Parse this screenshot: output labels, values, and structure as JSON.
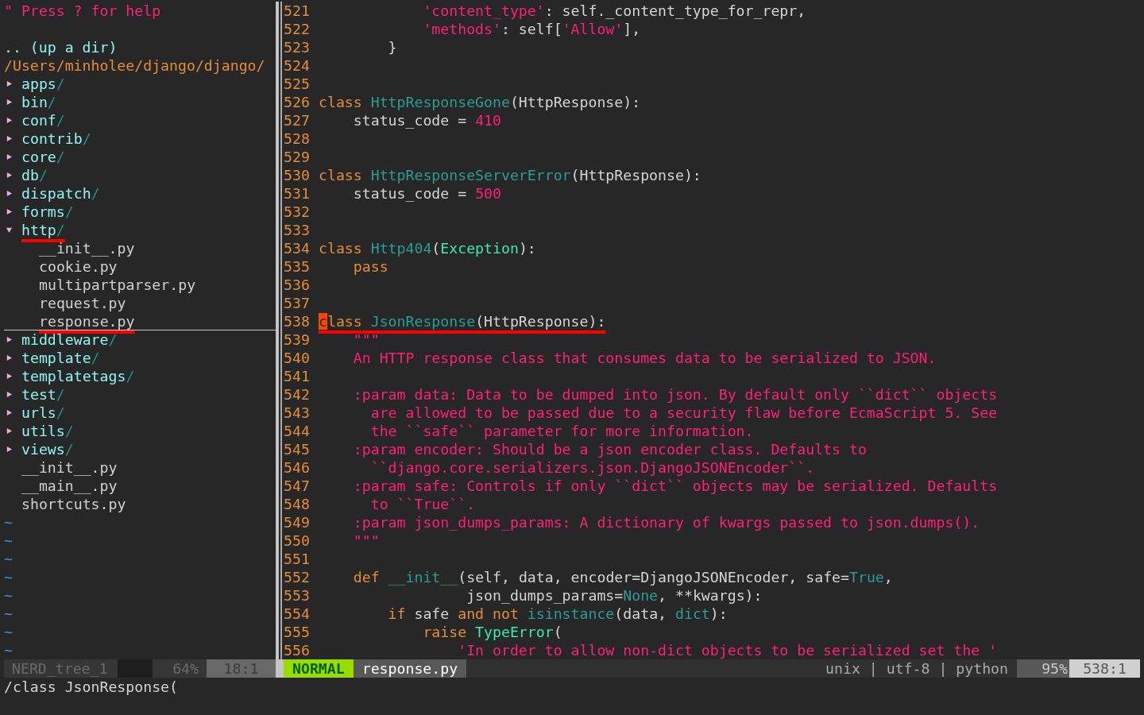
{
  "tree": {
    "help": "\" Press ? for help",
    "up_dir": ".. (up a dir)",
    "root_path": "/Users/minholee/django/django/",
    "items": [
      {
        "kind": "dir",
        "name": "apps",
        "slash": "/",
        "expanded": false,
        "selected": false,
        "marked": false
      },
      {
        "kind": "dir",
        "name": "bin",
        "slash": "/",
        "expanded": false,
        "selected": false,
        "marked": false
      },
      {
        "kind": "dir",
        "name": "conf",
        "slash": "/",
        "expanded": false,
        "selected": false,
        "marked": false
      },
      {
        "kind": "dir",
        "name": "contrib",
        "slash": "/",
        "expanded": false,
        "selected": false,
        "marked": false
      },
      {
        "kind": "dir",
        "name": "core",
        "slash": "/",
        "expanded": false,
        "selected": false,
        "marked": false
      },
      {
        "kind": "dir",
        "name": "db",
        "slash": "/",
        "expanded": false,
        "selected": false,
        "marked": false
      },
      {
        "kind": "dir",
        "name": "dispatch",
        "slash": "/",
        "expanded": false,
        "selected": false,
        "marked": false
      },
      {
        "kind": "dir",
        "name": "forms",
        "slash": "/",
        "expanded": false,
        "selected": false,
        "marked": false
      },
      {
        "kind": "dir",
        "name": "http",
        "slash": "/",
        "expanded": true,
        "selected": false,
        "marked": true,
        "children": [
          {
            "kind": "file",
            "name": "__init__.py",
            "selected": false,
            "marked": false
          },
          {
            "kind": "file",
            "name": "cookie.py",
            "selected": false,
            "marked": false
          },
          {
            "kind": "file",
            "name": "multipartparser.py",
            "selected": false,
            "marked": false
          },
          {
            "kind": "file",
            "name": "request.py",
            "selected": false,
            "marked": false
          },
          {
            "kind": "file",
            "name": "response.py",
            "selected": true,
            "marked": true
          }
        ]
      },
      {
        "kind": "dir",
        "name": "middleware",
        "slash": "/",
        "expanded": false,
        "selected": false,
        "marked": false
      },
      {
        "kind": "dir",
        "name": "template",
        "slash": "/",
        "expanded": false,
        "selected": false,
        "marked": false
      },
      {
        "kind": "dir",
        "name": "templatetags",
        "slash": "/",
        "expanded": false,
        "selected": false,
        "marked": false
      },
      {
        "kind": "dir",
        "name": "test",
        "slash": "/",
        "expanded": false,
        "selected": false,
        "marked": false
      },
      {
        "kind": "dir",
        "name": "urls",
        "slash": "/",
        "expanded": false,
        "selected": false,
        "marked": false
      },
      {
        "kind": "dir",
        "name": "utils",
        "slash": "/",
        "expanded": false,
        "selected": false,
        "marked": false
      },
      {
        "kind": "dir",
        "name": "views",
        "slash": "/",
        "expanded": false,
        "selected": false,
        "marked": false
      },
      {
        "kind": "file",
        "name": "__init__.py",
        "selected": false,
        "marked": false
      },
      {
        "kind": "file",
        "name": "__main__.py",
        "selected": false,
        "marked": false
      },
      {
        "kind": "file",
        "name": "shortcuts.py",
        "selected": false,
        "marked": false
      }
    ],
    "filler_lines": [
      "~",
      "~",
      "~",
      "~",
      "~",
      "~",
      "~",
      "~"
    ]
  },
  "code": [
    {
      "number": "521",
      "marked": false,
      "tokens": [
        {
          "kind": "str",
          "text": "            'content_type'"
        },
        {
          "kind": "plain",
          "text": ": self._content_type_for_repr,"
        }
      ]
    },
    {
      "number": "522",
      "marked": false,
      "tokens": [
        {
          "kind": "str",
          "text": "            'methods'"
        },
        {
          "kind": "plain",
          "text": ": self["
        },
        {
          "kind": "str",
          "text": "'Allow'"
        },
        {
          "kind": "plain",
          "text": "],"
        }
      ]
    },
    {
      "number": "523",
      "marked": false,
      "tokens": [
        {
          "kind": "plain",
          "text": "        }"
        }
      ]
    },
    {
      "number": "524",
      "marked": false
    },
    {
      "number": "525",
      "marked": false
    },
    {
      "number": "526",
      "marked": false,
      "tokens": [
        {
          "kind": "kw",
          "text": "class"
        },
        {
          "kind": "cls",
          "text": " HttpResponseGone"
        },
        {
          "kind": "plain",
          "text": "(HttpResponse):"
        }
      ]
    },
    {
      "number": "527",
      "marked": false,
      "tokens": [
        {
          "kind": "plain",
          "text": "    status_code = "
        },
        {
          "kind": "str",
          "text": "410"
        }
      ]
    },
    {
      "number": "528",
      "marked": false
    },
    {
      "number": "529",
      "marked": false
    },
    {
      "number": "530",
      "marked": false,
      "tokens": [
        {
          "kind": "kw",
          "text": "class"
        },
        {
          "kind": "cls",
          "text": " HttpResponseServerError"
        },
        {
          "kind": "plain",
          "text": "(HttpResponse):"
        }
      ]
    },
    {
      "number": "531",
      "marked": false,
      "tokens": [
        {
          "kind": "plain",
          "text": "    status_code = "
        },
        {
          "kind": "str",
          "text": "500"
        }
      ]
    },
    {
      "number": "532",
      "marked": false
    },
    {
      "number": "533",
      "marked": false
    },
    {
      "number": "534",
      "marked": false,
      "tokens": [
        {
          "kind": "kw",
          "text": "class"
        },
        {
          "kind": "cls",
          "text": " Http404"
        },
        {
          "kind": "plain",
          "text": "("
        },
        {
          "kind": "exc",
          "text": "Exception"
        },
        {
          "kind": "plain",
          "text": "):"
        }
      ]
    },
    {
      "number": "535",
      "marked": false,
      "tokens": [
        {
          "kind": "kw",
          "text": "    pass"
        }
      ]
    },
    {
      "number": "536",
      "marked": false
    },
    {
      "number": "537",
      "marked": false
    },
    {
      "number": "538",
      "marked": true,
      "tokens": [
        {
          "kind": "cursor",
          "text": "c"
        },
        {
          "kind": "kw",
          "text": "lass"
        },
        {
          "kind": "cls",
          "text": " JsonResponse"
        },
        {
          "kind": "plain",
          "text": "(HttpResponse):"
        }
      ]
    },
    {
      "number": "539",
      "marked": false,
      "tokens": [
        {
          "kind": "str",
          "text": "    \"\"\""
        }
      ]
    },
    {
      "number": "540",
      "marked": false,
      "tokens": [
        {
          "kind": "str",
          "text": "    An HTTP response class that consumes data to be serialized to JSON."
        }
      ]
    },
    {
      "number": "541",
      "marked": false
    },
    {
      "number": "542",
      "marked": false,
      "tokens": [
        {
          "kind": "str",
          "text": "    :param data: Data to be dumped into json. By default only ``dict`` objects"
        }
      ]
    },
    {
      "number": "543",
      "marked": false,
      "tokens": [
        {
          "kind": "str",
          "text": "      are allowed to be passed due to a security flaw before EcmaScript 5. See"
        }
      ]
    },
    {
      "number": "544",
      "marked": false,
      "tokens": [
        {
          "kind": "str",
          "text": "      the ``safe`` parameter for more information."
        }
      ]
    },
    {
      "number": "545",
      "marked": false,
      "tokens": [
        {
          "kind": "str",
          "text": "    :param encoder: Should be a json encoder class. Defaults to"
        }
      ]
    },
    {
      "number": "546",
      "marked": false,
      "tokens": [
        {
          "kind": "str",
          "text": "      ``django.core.serializers.json.DjangoJSONEncoder``."
        }
      ]
    },
    {
      "number": "547",
      "marked": false,
      "tokens": [
        {
          "kind": "str",
          "text": "    :param safe: Controls if only ``dict`` objects may be serialized. Defaults"
        }
      ]
    },
    {
      "number": "548",
      "marked": false,
      "tokens": [
        {
          "kind": "str",
          "text": "      to ``True``."
        }
      ]
    },
    {
      "number": "549",
      "marked": false,
      "tokens": [
        {
          "kind": "str",
          "text": "    :param json_dumps_params: A dictionary of kwargs passed to json.dumps()."
        }
      ]
    },
    {
      "number": "550",
      "marked": false,
      "tokens": [
        {
          "kind": "str",
          "text": "    \"\"\""
        }
      ]
    },
    {
      "number": "551",
      "marked": false
    },
    {
      "number": "552",
      "marked": false,
      "tokens": [
        {
          "kind": "kw",
          "text": "    def"
        },
        {
          "kind": "cls",
          "text": " __init__"
        },
        {
          "kind": "plain",
          "text": "(self, data, encoder=DjangoJSONEncoder, safe="
        },
        {
          "kind": "cls",
          "text": "True"
        },
        {
          "kind": "plain",
          "text": ","
        }
      ]
    },
    {
      "number": "553",
      "marked": false,
      "tokens": [
        {
          "kind": "plain",
          "text": "                 json_dumps_params="
        },
        {
          "kind": "cls",
          "text": "None"
        },
        {
          "kind": "plain",
          "text": ", **kwargs):"
        }
      ]
    },
    {
      "number": "554",
      "marked": false,
      "tokens": [
        {
          "kind": "kw",
          "text": "        if"
        },
        {
          "kind": "plain",
          "text": " safe "
        },
        {
          "kind": "kw",
          "text": "and not"
        },
        {
          "kind": "cls",
          "text": " isinstance"
        },
        {
          "kind": "plain",
          "text": "(data, "
        },
        {
          "kind": "cls",
          "text": "dict"
        },
        {
          "kind": "plain",
          "text": "):"
        }
      ]
    },
    {
      "number": "555",
      "marked": false,
      "tokens": [
        {
          "kind": "kw",
          "text": "            raise"
        },
        {
          "kind": "exc",
          "text": " TypeError"
        },
        {
          "kind": "plain",
          "text": "("
        }
      ]
    },
    {
      "number": "556",
      "marked": false,
      "tokens": [
        {
          "kind": "str",
          "text": "                'In order to allow non-dict objects to be serialized set the '"
        }
      ]
    }
  ],
  "tree_status": {
    "name": "NERD_tree_1",
    "percent": "64%",
    "position": "18:1"
  },
  "editor_status": {
    "mode": "NORMAL",
    "file": "response.py",
    "info": "unix | utf-8 | python",
    "percent": "95%",
    "position": "538:1"
  },
  "command_line": "/class JsonResponse("
}
